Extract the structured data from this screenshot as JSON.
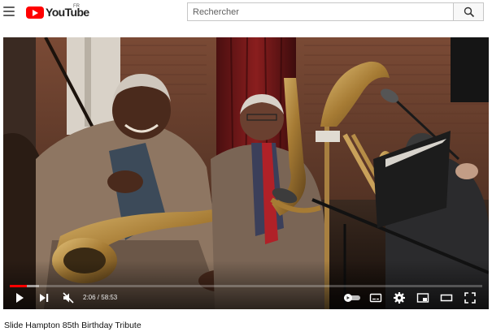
{
  "header": {
    "logo_text": "YouTube",
    "region_code": "FR",
    "search_placeholder": "Rechercher"
  },
  "player": {
    "current_time": "2:06",
    "duration": "58:53",
    "time_display": "2:06 / 58:53",
    "progress_played_fraction": 0.036,
    "progress_loaded_fraction": 0.062,
    "muted": true,
    "colors": {
      "progress_played": "#ff0000",
      "brand": "#ff0000"
    }
  },
  "video": {
    "title": "Slide Hampton 85th Birthday Tribute"
  },
  "icons": [
    "menu-icon",
    "youtube-logo-icon",
    "search-icon",
    "play-icon",
    "next-icon",
    "muted-volume-icon",
    "autoplay-toggle-icon",
    "subtitles-icon",
    "settings-icon",
    "miniplayer-icon",
    "theater-mode-icon",
    "fullscreen-icon"
  ]
}
